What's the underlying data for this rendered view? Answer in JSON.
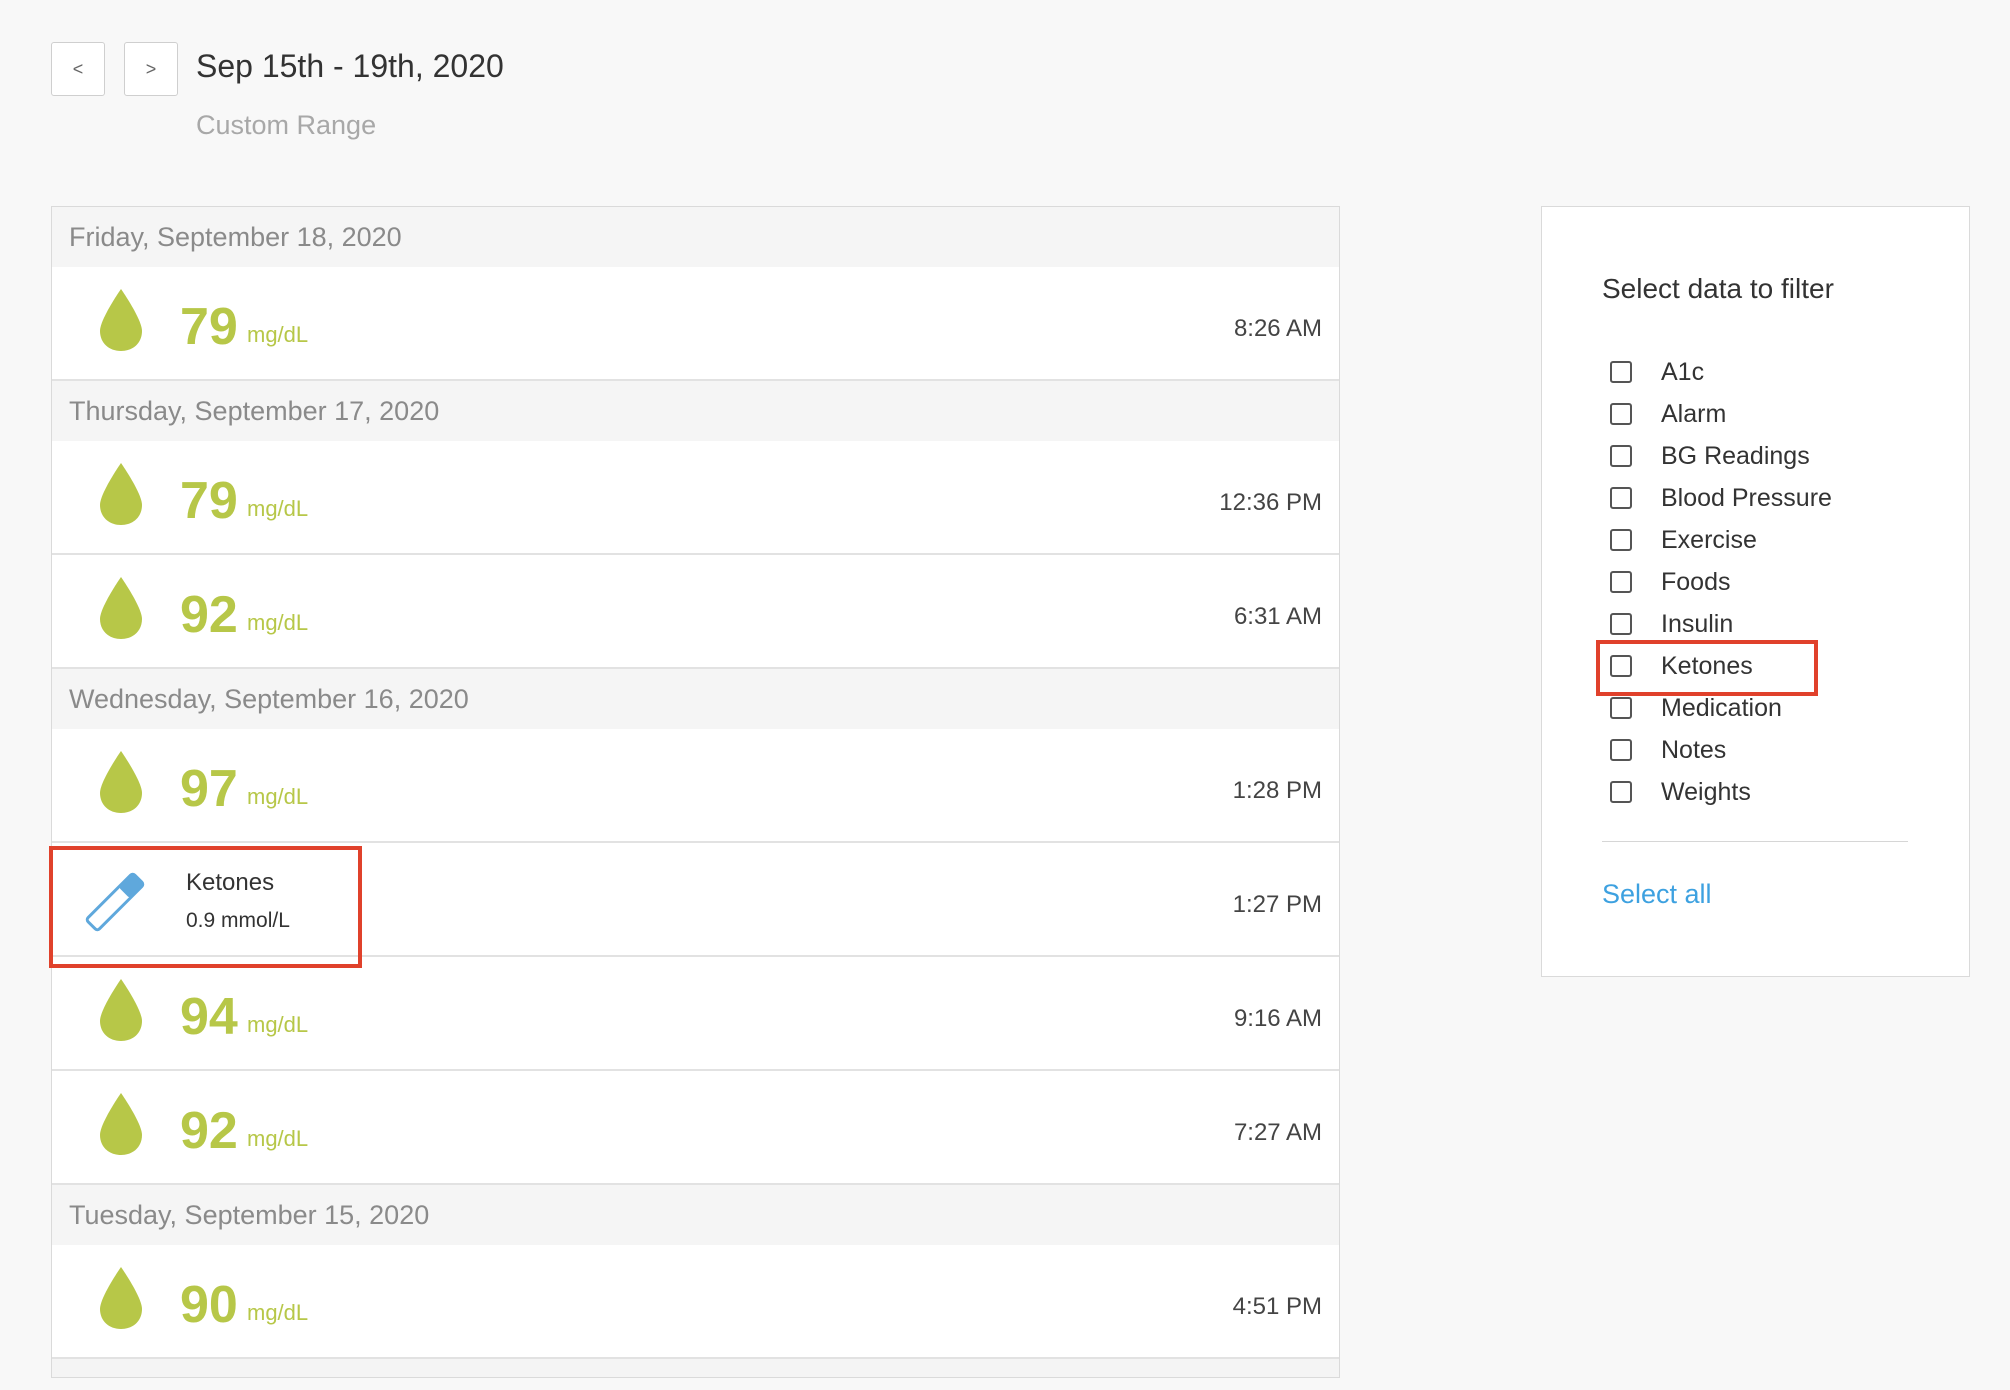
{
  "header": {
    "prev_label": "<",
    "next_label": ">",
    "range_title": "Sep 15th - 19th, 2020",
    "range_subtitle": "Custom Range"
  },
  "colors": {
    "bg_reading": "#b7c748",
    "link": "#3da1e0",
    "highlight": "#e0412b",
    "ketone_icon": "#5fa8dc"
  },
  "log": {
    "days": [
      {
        "label": "Friday, September 18, 2020",
        "entries": [
          {
            "type": "bg",
            "icon": "drop-icon",
            "value": "79",
            "unit": "mg/dL",
            "time": "8:26 AM"
          }
        ]
      },
      {
        "label": "Thursday, September 17, 2020",
        "entries": [
          {
            "type": "bg",
            "icon": "drop-icon",
            "value": "79",
            "unit": "mg/dL",
            "time": "12:36 PM"
          },
          {
            "type": "bg",
            "icon": "drop-icon",
            "value": "92",
            "unit": "mg/dL",
            "time": "6:31 AM"
          }
        ]
      },
      {
        "label": "Wednesday, September 16, 2020",
        "entries": [
          {
            "type": "bg",
            "icon": "drop-icon",
            "value": "97",
            "unit": "mg/dL",
            "time": "1:28 PM"
          },
          {
            "type": "ketone",
            "icon": "test-strip-icon",
            "title": "Ketones",
            "value": "0.9 mmol/L",
            "time": "1:27 PM"
          },
          {
            "type": "bg",
            "icon": "drop-icon",
            "value": "94",
            "unit": "mg/dL",
            "time": "9:16 AM"
          },
          {
            "type": "bg",
            "icon": "drop-icon",
            "value": "92",
            "unit": "mg/dL",
            "time": "7:27 AM"
          }
        ]
      },
      {
        "label": "Tuesday, September 15, 2020",
        "entries": [
          {
            "type": "bg",
            "icon": "drop-icon",
            "value": "90",
            "unit": "mg/dL",
            "time": "4:51 PM"
          }
        ]
      }
    ]
  },
  "filter": {
    "title": "Select data to filter",
    "options": [
      {
        "label": "A1c",
        "checked": false
      },
      {
        "label": "Alarm",
        "checked": false
      },
      {
        "label": "BG Readings",
        "checked": false
      },
      {
        "label": "Blood Pressure",
        "checked": false
      },
      {
        "label": "Exercise",
        "checked": false
      },
      {
        "label": "Foods",
        "checked": false
      },
      {
        "label": "Insulin",
        "checked": false
      },
      {
        "label": "Ketones",
        "checked": false
      },
      {
        "label": "Medication",
        "checked": false
      },
      {
        "label": "Notes",
        "checked": false
      },
      {
        "label": "Weights",
        "checked": false
      }
    ],
    "select_all_label": "Select all"
  }
}
